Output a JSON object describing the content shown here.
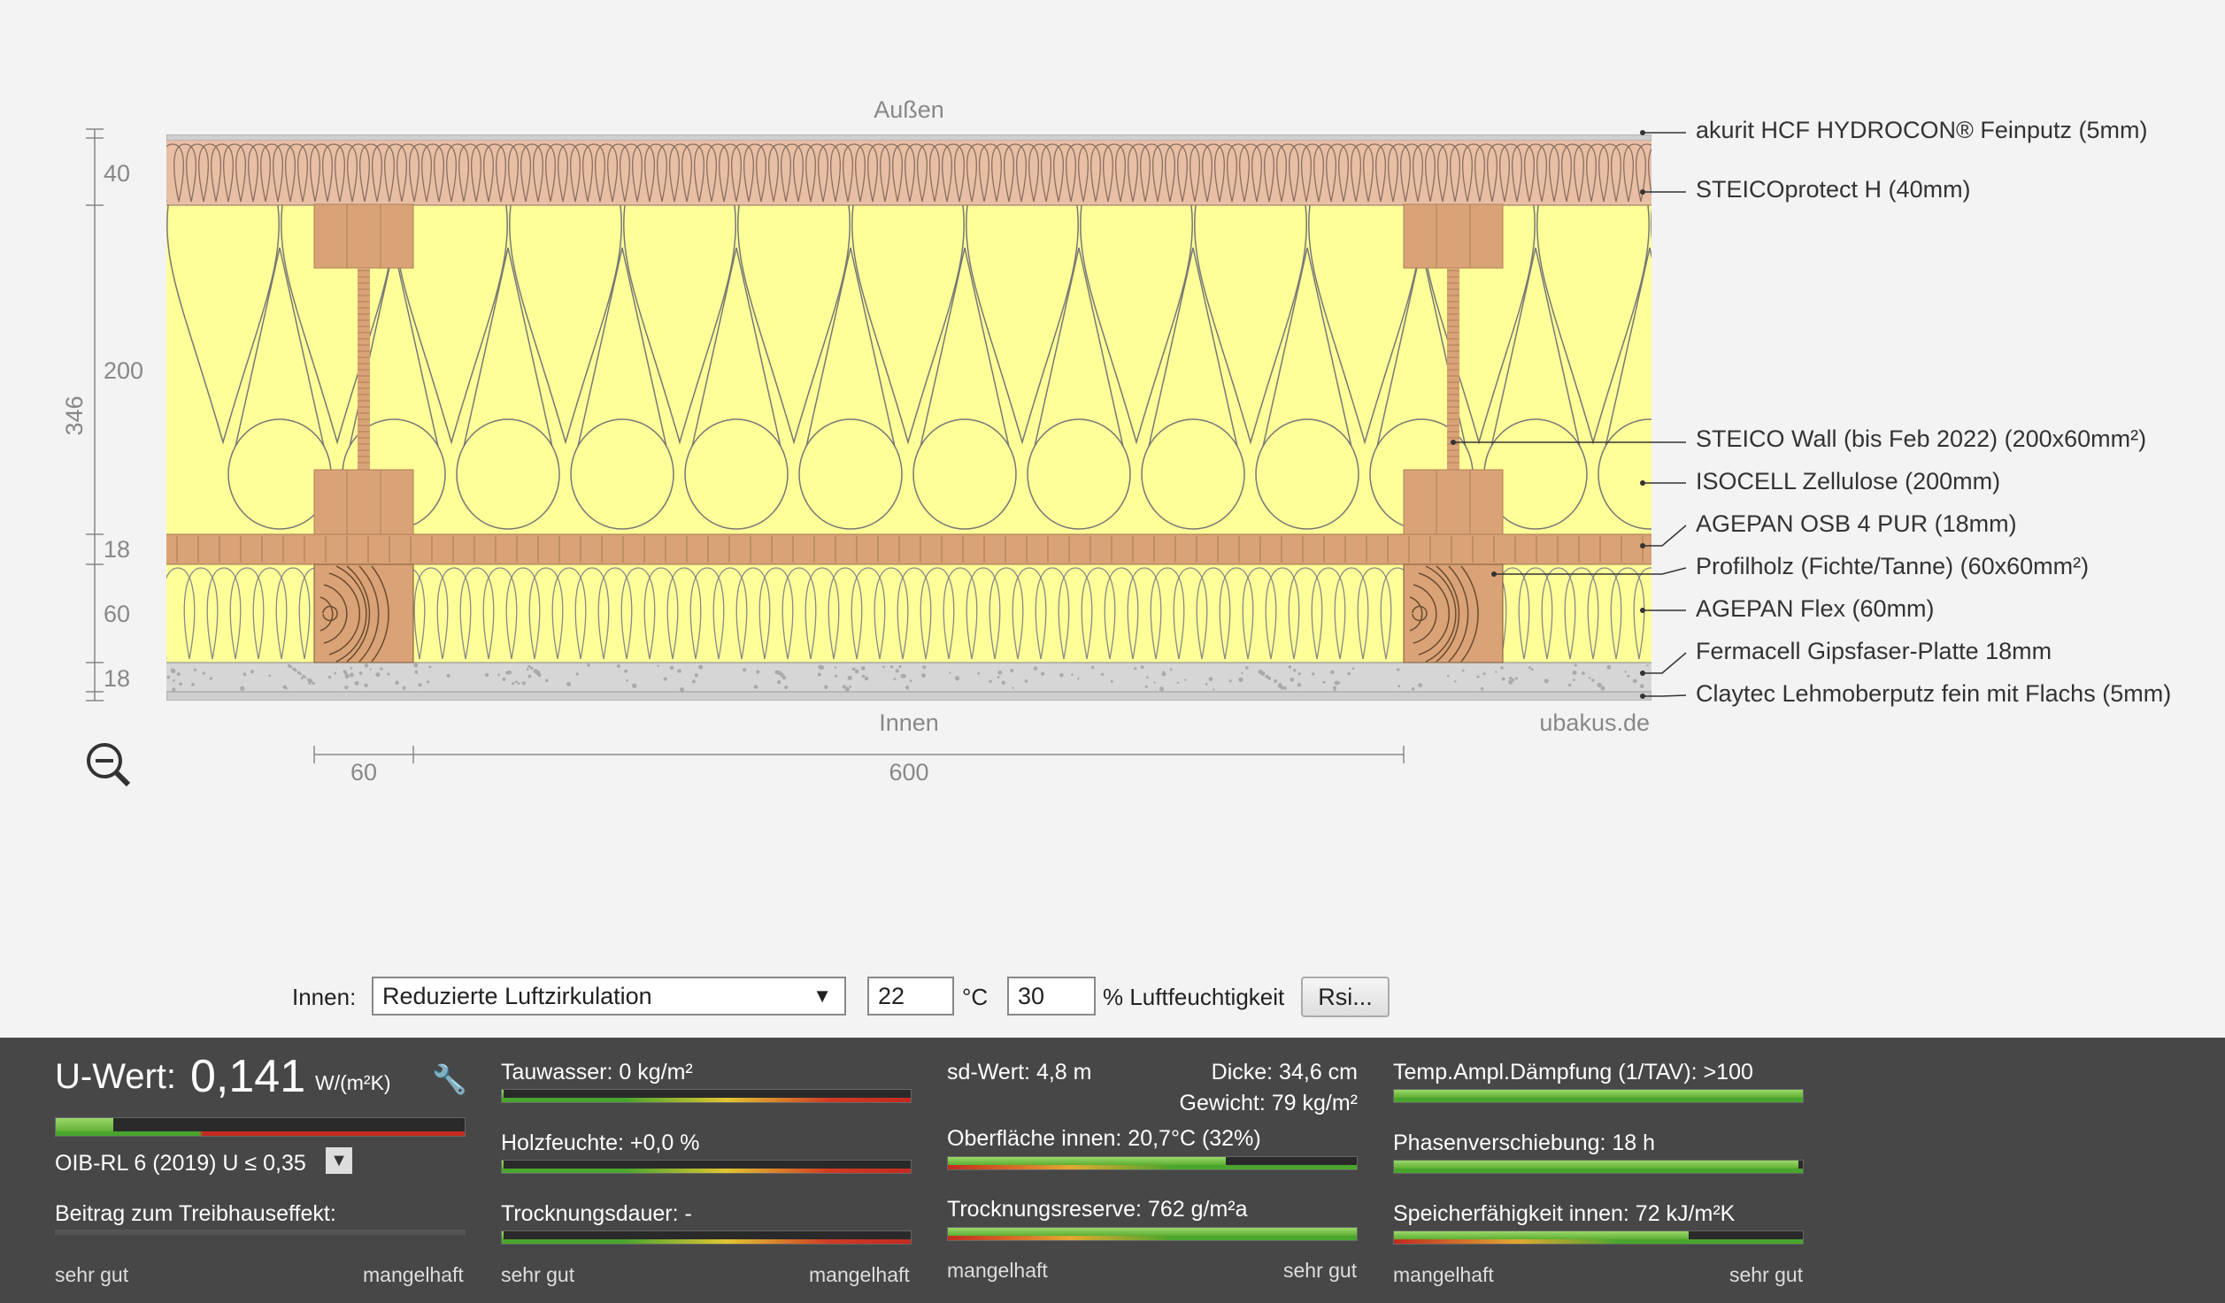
{
  "drawing": {
    "outside_label": "Außen",
    "inside_label": "Innen",
    "watermark": "ubakus.de",
    "dim_total": "346",
    "dim_layers": [
      "40",
      "200",
      "18",
      "60",
      "18"
    ],
    "dim_bottom": [
      "60",
      "600"
    ],
    "layers": [
      "akurit HCF HYDROCON® Feinputz (5mm)",
      "STEICOprotect H (40mm)",
      "STEICO  Wall (bis Feb 2022) (200x60mm²)",
      "ISOCELL Zellulose (200mm)",
      "AGEPAN OSB 4 PUR (18mm)",
      "Profilholz (Fichte/Tanne) (60x60mm²)",
      "AGEPAN Flex (60mm)",
      "Fermacell Gipsfaser-Platte 18mm",
      "Claytec Lehmoberputz fein mit Flachs (5mm)"
    ],
    "colors": {
      "fibre_board": "#e8bfa5",
      "insulation": "#ffff99",
      "wood": "#d9a377",
      "gypsum": "#d6d6d6"
    }
  },
  "controls": {
    "innen_label": "Innen:",
    "select_value": "Reduzierte Luftzirkulation",
    "temp_value": "22",
    "temp_unit": "°C",
    "humidity_value": "30",
    "humidity_unit": "% Luftfeuchtigkeit",
    "rsi_button": "Rsi..."
  },
  "results": {
    "uwert_label": "U-Wert:",
    "uwert_value": "0,141",
    "uwert_unit": "W/(m²K)",
    "uwert_level": 0.14,
    "norm": "OIB-RL 6 (2019) U ≤ 0,35",
    "treibhaus": "Beitrag zum Treibhauseffekt:",
    "tauwasser": "Tauwasser: 0 kg/m²",
    "tauwasser_level": 0.005,
    "holzfeuchte": "Holzfeuchte: +0,0 %",
    "holzfeuchte_level": 0.005,
    "trocknungsdauer": "Trocknungsdauer: -",
    "trocknungsdauer_level": 0.005,
    "sdwert": "sd-Wert: 4,8 m",
    "dicke": "Dicke: 34,6 cm",
    "gewicht": "Gewicht: 79 kg/m²",
    "oberflaeche": "Oberfläche innen: 20,7°C (32%)",
    "oberflaeche_level": 0.68,
    "trocknungsreserve": "Trocknungsreserve: 762 g/m²a",
    "trocknungsreserve_level": 1.0,
    "temp_ampl": "Temp.Ampl.Dämpfung (1/TAV): >100",
    "temp_ampl_level": 1.0,
    "phasen": "Phasenverschiebung: 18 h",
    "phasen_level": 0.99,
    "speicher": "Speicherfähigkeit innen: 72 kJ/m²K",
    "speicher_level": 0.72,
    "scale_good": "sehr gut",
    "scale_bad": "mangelhaft"
  }
}
